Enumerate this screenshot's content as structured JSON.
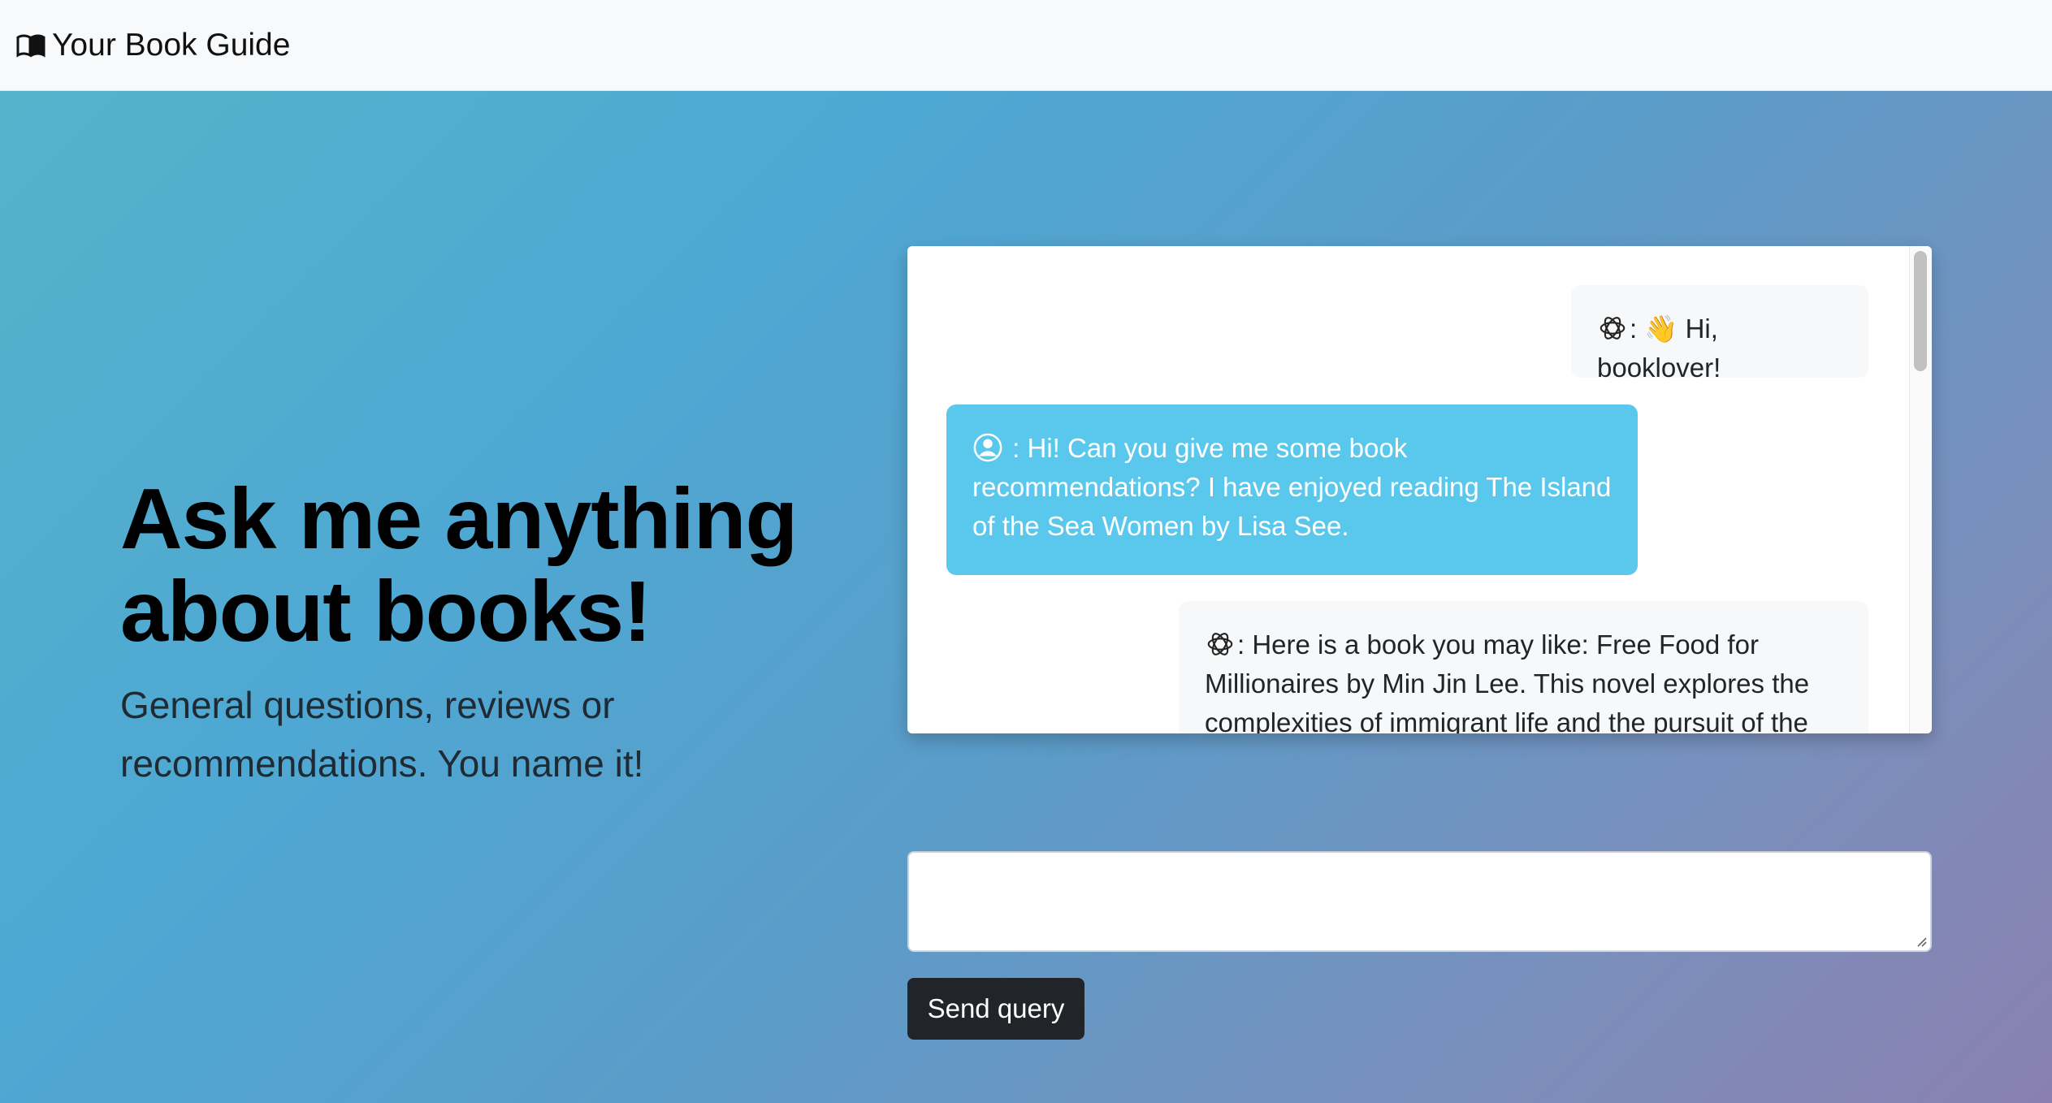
{
  "navbar": {
    "brand_icon": "open-book-icon",
    "brand_label": "Your Book Guide"
  },
  "hero": {
    "headline": "Ask me anything about books!",
    "subtitle": "General questions, reviews or recommendations. You name it!"
  },
  "chat": {
    "messages": [
      {
        "role": "bot",
        "icon": "openai-icon",
        "text": ": 👋 Hi, booklover!"
      },
      {
        "role": "user",
        "icon": "user-avatar-icon",
        "text": " : Hi! Can you give me some book recommendations? I have enjoyed reading The Island of the Sea Women by Lisa See."
      },
      {
        "role": "bot",
        "icon": "openai-icon",
        "text": ": Here is a book you may like: Free Food for Millionaires by Min Jin Lee. This novel explores the complexities of immigrant life and the pursuit of the"
      }
    ]
  },
  "input": {
    "value": "",
    "send_label": "Send query"
  },
  "colors": {
    "user_bubble": "#5ac8ec",
    "bot_bubble": "#f7f8f9",
    "button": "#212529",
    "gradient_start": "#56b2cb",
    "gradient_end": "#8a80b0"
  }
}
